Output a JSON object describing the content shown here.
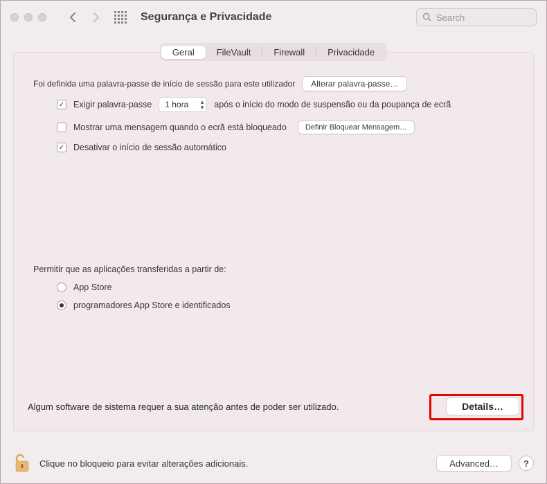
{
  "toolbar": {
    "title": "Segurança e Privacidade",
    "search_placeholder": "Search"
  },
  "tabs": {
    "general": "Geral",
    "filevault": "FileVault",
    "firewall": "Firewall",
    "privacy": "Privacidade"
  },
  "general": {
    "password_set_label": "Foi definida uma palavra-passe de início de sessão para este utilizador",
    "change_password_btn": "Alterar palavra-passe…",
    "require_password_label_prefix": "Exigir palavra-passe",
    "require_password_delay": "1 hora",
    "require_password_suffix": "após o início do modo de suspensão ou da poupança de ecrã",
    "show_message_label": "Mostrar uma mensagem quando o ecrã está bloqueado",
    "set_lock_message_btn": "Definir Bloquear Mensagem…",
    "disable_auto_login_label": "Desativar o início de sessão automático",
    "allow_apps_label": "Permitir que as aplicações transferidas a partir de:",
    "allow_appstore": "App Store",
    "allow_identified": "programadores App Store e identificados",
    "attention_text": "Algum software de sistema requer a sua atenção antes de poder ser utilizado.",
    "details_btn": "Details…"
  },
  "footer": {
    "lock_text": "Clique no bloqueio para evitar alterações adicionais.",
    "advanced_btn": "Advanced…"
  }
}
